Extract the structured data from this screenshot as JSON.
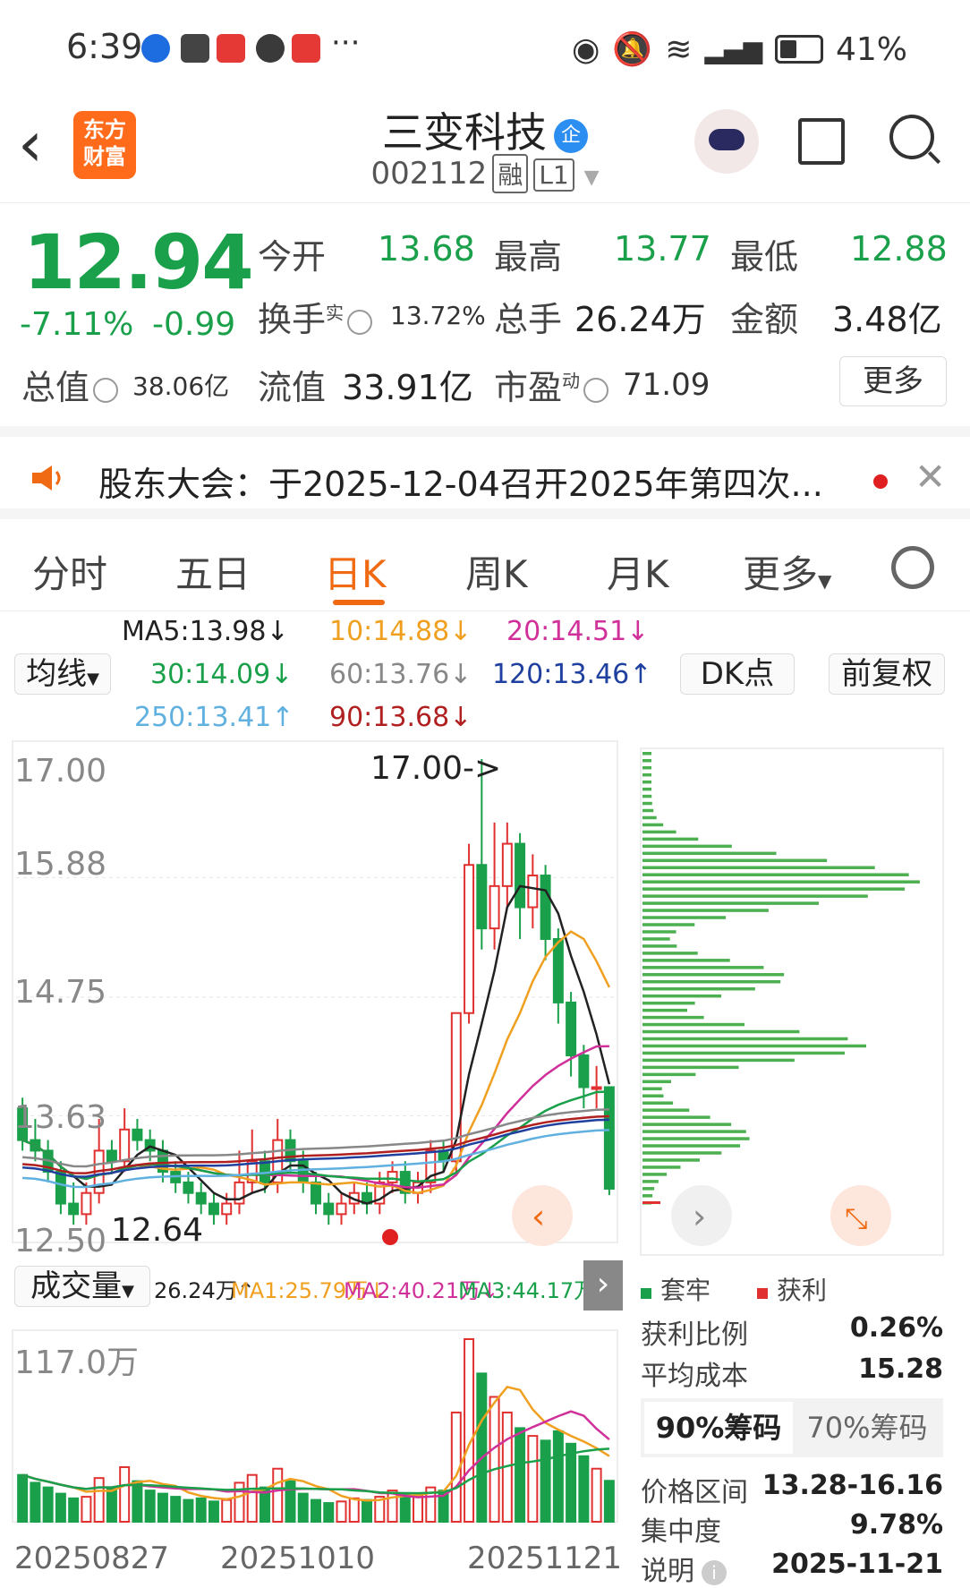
{
  "status": {
    "time": "6:39",
    "dots": "···",
    "battery": "41%"
  },
  "header": {
    "title": "三变科技",
    "badge": "企",
    "code": "002112",
    "tag1": "融",
    "tag2": "L1",
    "logo": "东方财富"
  },
  "quote": {
    "price": "12.94",
    "pct": "-7.11%",
    "chg": "-0.99",
    "open_label": "今开",
    "open": "13.68",
    "high_label": "最高",
    "high": "13.77",
    "low_label": "最低",
    "low": "12.88",
    "turnover_label": "换手",
    "turnover_sup": "实",
    "turnover": "13.72%",
    "volume_label": "总手",
    "volume": "26.24万",
    "amount_label": "金额",
    "amount": "3.48亿",
    "mcap_label": "总值",
    "mcap": "38.06亿",
    "float_label": "流值",
    "float": "33.91亿",
    "pe_label": "市盈",
    "pe_sup": "动",
    "pe": "71.09",
    "more": "更多"
  },
  "notice": {
    "text": "股东大会：于2025-12-04召开2025年第四次..."
  },
  "tabs": [
    "分时",
    "五日",
    "日K",
    "周K",
    "月K",
    "更多"
  ],
  "ma": {
    "selector": "均线",
    "ma5": "MA5:13.98↓",
    "ma10": "10:14.88↓",
    "ma20": "20:14.51↓",
    "ma30": "30:14.09↓",
    "ma60": "60:13.76↓",
    "ma120": "120:13.46↑",
    "ma250": "250:13.41↑",
    "ma90": "90:13.68↓",
    "dk": "DK点",
    "adjust": "前复权"
  },
  "colors": {
    "up": "#e03030",
    "down": "#1aa04a",
    "accent": "#f06a14"
  },
  "kline": {
    "y_labels": [
      "17.00",
      "15.88",
      "14.75",
      "13.63",
      "12.50"
    ],
    "max_marker": "17.00->",
    "min_marker": "12.64"
  },
  "volume": {
    "selector": "成交量",
    "vol": "26.24万↑",
    "ma1": "MA1:25.79万↓",
    "ma2": "MA2:40.21万↓",
    "ma3": "MA3:44.17万↑",
    "max_label": "117.0万",
    "dates": [
      "20250827",
      "20251010",
      "20251121"
    ]
  },
  "chips": {
    "legend_trap": "套牢",
    "legend_profit": "获利",
    "profit_ratio_label": "获利比例",
    "profit_ratio": "0.26%",
    "avg_cost_label": "平均成本",
    "avg_cost": "15.28",
    "tab90": "90%筹码",
    "tab70": "70%筹码",
    "range_label": "价格区间",
    "range": "13.28-16.16",
    "conc_label": "集中度",
    "conc": "9.78%",
    "note_label": "说明",
    "note": "2025-11-21"
  },
  "chart_data": {
    "type": "candlestick",
    "ylim": [
      12.5,
      17.0
    ],
    "candles": [
      [
        13.7,
        13.4,
        13.8,
        13.3
      ],
      [
        13.4,
        13.3,
        13.6,
        13.2
      ],
      [
        13.3,
        13.1,
        13.4,
        13.0
      ],
      [
        13.1,
        12.8,
        13.2,
        12.7
      ],
      [
        12.8,
        12.7,
        13.0,
        12.6
      ],
      [
        12.7,
        12.9,
        13.0,
        12.6
      ],
      [
        12.9,
        13.3,
        13.6,
        12.8
      ],
      [
        13.3,
        13.2,
        13.4,
        13.1
      ],
      [
        13.2,
        13.5,
        13.7,
        13.1
      ],
      [
        13.5,
        13.4,
        13.6,
        13.3
      ],
      [
        13.4,
        13.3,
        13.5,
        13.2
      ],
      [
        13.3,
        13.1,
        13.4,
        13.0
      ],
      [
        13.1,
        13.0,
        13.2,
        12.9
      ],
      [
        13.0,
        12.9,
        13.1,
        12.8
      ],
      [
        12.9,
        12.8,
        13.0,
        12.7
      ],
      [
        12.8,
        12.7,
        12.9,
        12.6
      ],
      [
        12.7,
        12.8,
        12.9,
        12.6
      ],
      [
        12.8,
        13.0,
        13.3,
        12.7
      ],
      [
        13.0,
        13.2,
        13.5,
        12.9
      ],
      [
        13.2,
        13.0,
        13.3,
        12.9
      ],
      [
        13.0,
        13.4,
        13.6,
        12.9
      ],
      [
        13.4,
        13.2,
        13.5,
        13.1
      ],
      [
        13.2,
        13.0,
        13.3,
        12.9
      ],
      [
        13.0,
        12.8,
        13.1,
        12.7
      ],
      [
        12.8,
        12.7,
        12.9,
        12.6
      ],
      [
        12.7,
        12.8,
        12.9,
        12.6
      ],
      [
        12.8,
        12.9,
        13.0,
        12.7
      ],
      [
        12.9,
        12.8,
        13.0,
        12.7
      ],
      [
        12.8,
        13.0,
        13.1,
        12.7
      ],
      [
        13.0,
        13.1,
        13.2,
        12.9
      ],
      [
        13.1,
        12.9,
        13.2,
        12.8
      ],
      [
        12.9,
        13.0,
        13.1,
        12.8
      ],
      [
        13.0,
        13.3,
        13.4,
        12.9
      ],
      [
        13.3,
        13.2,
        13.4,
        13.1
      ],
      [
        13.2,
        14.6,
        14.6,
        13.1
      ],
      [
        14.6,
        16.0,
        16.2,
        14.5
      ],
      [
        16.0,
        15.4,
        17.0,
        15.2
      ],
      [
        15.4,
        15.8,
        16.4,
        15.2
      ],
      [
        15.8,
        16.2,
        16.4,
        15.6
      ],
      [
        16.2,
        15.6,
        16.3,
        15.3
      ],
      [
        15.6,
        15.9,
        16.1,
        15.4
      ],
      [
        15.9,
        15.3,
        16.0,
        15.1
      ],
      [
        15.3,
        14.7,
        15.4,
        14.5
      ],
      [
        14.7,
        14.2,
        14.8,
        14.0
      ],
      [
        14.2,
        13.9,
        14.3,
        13.7
      ],
      [
        13.9,
        13.9,
        14.1,
        13.7
      ],
      [
        13.9,
        12.94,
        13.77,
        12.88
      ]
    ],
    "volumes": [
      30,
      25,
      22,
      18,
      15,
      16,
      28,
      22,
      35,
      26,
      20,
      18,
      16,
      14,
      15,
      13,
      14,
      25,
      30,
      22,
      34,
      26,
      18,
      14,
      12,
      13,
      15,
      14,
      16,
      20,
      18,
      17,
      22,
      20,
      70,
      117,
      95,
      80,
      70,
      60,
      55,
      52,
      58,
      50,
      42,
      34,
      26.24
    ],
    "series": [
      {
        "name": "MA5",
        "color": "#222222"
      },
      {
        "name": "MA10",
        "color": "#f0a020"
      },
      {
        "name": "MA20",
        "color": "#d0309a"
      },
      {
        "name": "MA30",
        "color": "#1aa04a"
      },
      {
        "name": "MA60",
        "color": "#888888"
      },
      {
        "name": "MA120",
        "color": "#2040a0"
      },
      {
        "name": "MA250",
        "color": "#60b0e0"
      },
      {
        "name": "MA90",
        "color": "#b02020"
      }
    ]
  }
}
